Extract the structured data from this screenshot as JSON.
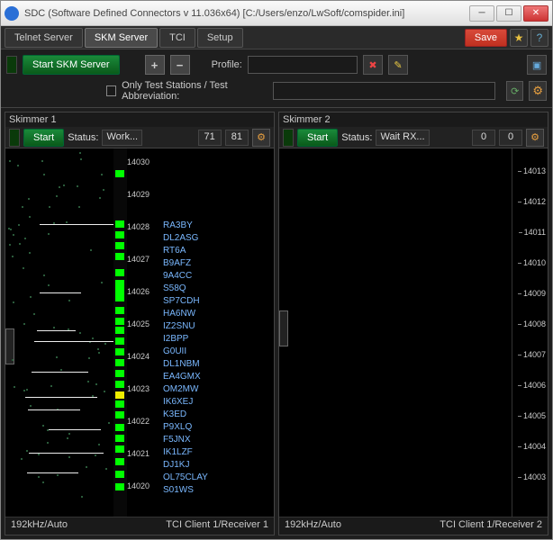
{
  "window": {
    "title": "SDC (Software Defined Connectors v 11.036x64) [C:/Users/enzo/LwSoft/comspider.ini]"
  },
  "tabs": {
    "items": [
      "Telnet Server",
      "SKM Server",
      "TCI",
      "Setup"
    ],
    "active": 1,
    "save": "Save"
  },
  "toolbar": {
    "start_skm": "Start SKM Server",
    "profile_label": "Profile:",
    "checkbox_label": "Only Test Stations / Test Abbreviation:"
  },
  "skimmer1": {
    "title": "Skimmer 1",
    "start": "Start",
    "status_label": "Status:",
    "status": "Work...",
    "num1": "71",
    "num2": "81",
    "footer_left": "192kHz/Auto",
    "footer_right": "TCI Client 1/Receiver 1",
    "freqs": [
      "14030",
      "14029",
      "14028",
      "14027",
      "14026",
      "14025",
      "14024",
      "14023",
      "14022",
      "14021",
      "14020"
    ],
    "calls": [
      "RA3BY",
      "DL2ASG",
      "RT6A",
      "B9AFZ",
      "9A4CC",
      "S58Q",
      "SP7CDH",
      "HA6NW",
      "IZ2SNU",
      "I2BPP",
      "G0UII",
      "DL1NBM",
      "EA4GMX",
      "OM2MW",
      "IK6XEJ",
      "K3ED",
      "P9XLQ",
      "F5JNX",
      "IK1LZF",
      "DJ1KJ",
      "OL75CLAY",
      "S01WS"
    ]
  },
  "skimmer2": {
    "title": "Skimmer 2",
    "start": "Start",
    "status_label": "Status:",
    "status": "Wait RX...",
    "num1": "0",
    "num2": "0",
    "footer_left": "192kHz/Auto",
    "footer_right": "TCI Client 1/Receiver 2",
    "freqs": [
      "14013",
      "14012",
      "14011",
      "14010",
      "14009",
      "14008",
      "14007",
      "14006",
      "14005",
      "14004",
      "14003"
    ]
  }
}
